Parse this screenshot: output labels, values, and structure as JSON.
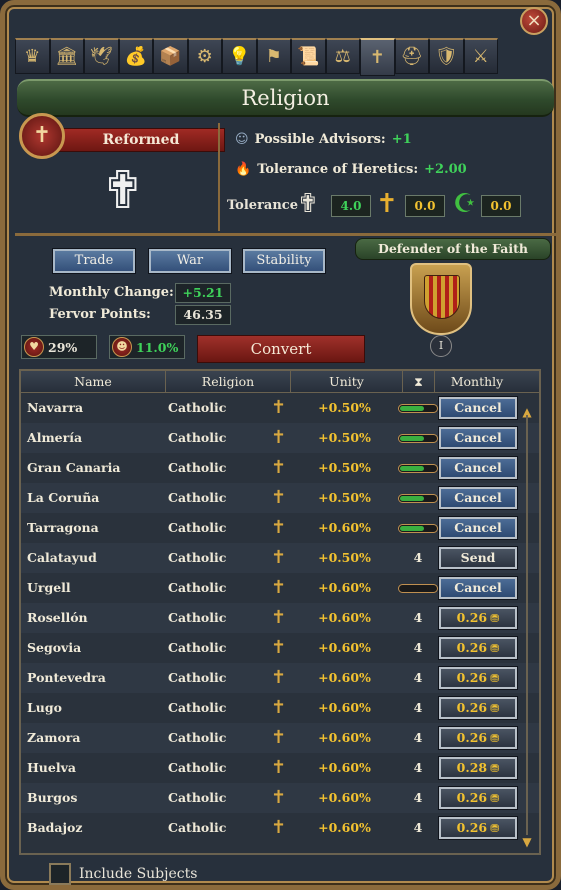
{
  "window": {
    "title": "Religion",
    "close_icon": "×"
  },
  "tabs": [
    {
      "icon": "crown-icon",
      "glyph": "♛"
    },
    {
      "icon": "courthouse-icon",
      "glyph": "🏛"
    },
    {
      "icon": "dove-icon",
      "glyph": "🕊"
    },
    {
      "icon": "money-bags-icon",
      "glyph": "💰"
    },
    {
      "icon": "trade-goods-icon",
      "glyph": "📦"
    },
    {
      "icon": "gears-icon",
      "glyph": "⚙"
    },
    {
      "icon": "lightbulb-icon",
      "glyph": "💡"
    },
    {
      "icon": "flag-icon",
      "glyph": "⚑"
    },
    {
      "icon": "scroll-icon",
      "glyph": "📜"
    },
    {
      "icon": "estates-icon",
      "glyph": "⚖"
    },
    {
      "icon": "religion-cross-icon",
      "glyph": "✝",
      "active": true
    },
    {
      "icon": "helmet-icon",
      "glyph": "⛑"
    },
    {
      "icon": "coat-of-arms-icon",
      "glyph": "🛡"
    },
    {
      "icon": "crossed-swords-icon",
      "glyph": "⚔"
    }
  ],
  "religion": {
    "name": "Reformed",
    "emblem_glyph": "✝",
    "cross_glyph": "✟",
    "possible_advisors_label": "Possible Advisors:",
    "possible_advisors_value": "+1",
    "tolerance_heretics_label": "Tolerance of Heretics:",
    "tolerance_heretics_value": "+2.00",
    "tolerance_label": "Tolerance",
    "tolerance": [
      {
        "icon": "reformed-cross-icon",
        "glyph": "✟",
        "value": "4.0",
        "color": "#f0f0f0"
      },
      {
        "icon": "catholic-cross-icon",
        "glyph": "✝",
        "value": "0.0",
        "color": "#e8b030"
      },
      {
        "icon": "crescent-icon",
        "glyph": "☪",
        "value": "0.0",
        "color": "#40c040"
      }
    ]
  },
  "fervor": {
    "buttons": [
      "Trade",
      "War",
      "Stability"
    ],
    "monthly_change_label": "Monthly Change:",
    "monthly_change_value": "+5.21",
    "fervor_points_label": "Fervor Points:",
    "fervor_points_value": "46.35",
    "defender_title": "Defender of the Faith",
    "defender_rank": "I",
    "religious_unity": "29%",
    "missionary_strength": "11.0%",
    "convert_label": "Convert"
  },
  "table": {
    "headers": [
      "Name",
      "Religion",
      "Unity",
      "⧗",
      "Monthly Cost"
    ],
    "rows": [
      {
        "name": "Navarra",
        "religion": "Catholic",
        "unity": "+0.50%",
        "timer": "bar",
        "progress": 0.6,
        "cost": "Cancel",
        "style": "blue"
      },
      {
        "name": "Almería",
        "religion": "Catholic",
        "unity": "+0.50%",
        "timer": "bar",
        "progress": 0.6,
        "cost": "Cancel",
        "style": "blue"
      },
      {
        "name": "Gran Canaria",
        "religion": "Catholic",
        "unity": "+0.50%",
        "timer": "bar",
        "progress": 0.6,
        "cost": "Cancel",
        "style": "blue"
      },
      {
        "name": "La Coruña",
        "religion": "Catholic",
        "unity": "+0.50%",
        "timer": "bar",
        "progress": 0.6,
        "cost": "Cancel",
        "style": "blue"
      },
      {
        "name": "Tarragona",
        "religion": "Catholic",
        "unity": "+0.60%",
        "timer": "bar",
        "progress": 0.6,
        "cost": "Cancel",
        "style": "blue"
      },
      {
        "name": "Calatayud",
        "religion": "Catholic",
        "unity": "+0.50%",
        "timer": "4",
        "cost": "Send",
        "style": "grey"
      },
      {
        "name": "Urgell",
        "religion": "Catholic",
        "unity": "+0.60%",
        "timer": "bar",
        "progress": 0.0,
        "cost": "Cancel",
        "style": "blue"
      },
      {
        "name": "Rosellón",
        "religion": "Catholic",
        "unity": "+0.60%",
        "timer": "4",
        "cost": "0.26",
        "style": "gold"
      },
      {
        "name": "Segovia",
        "religion": "Catholic",
        "unity": "+0.60%",
        "timer": "4",
        "cost": "0.26",
        "style": "gold"
      },
      {
        "name": "Pontevedra",
        "religion": "Catholic",
        "unity": "+0.60%",
        "timer": "4",
        "cost": "0.26",
        "style": "gold"
      },
      {
        "name": "Lugo",
        "religion": "Catholic",
        "unity": "+0.60%",
        "timer": "4",
        "cost": "0.26",
        "style": "gold"
      },
      {
        "name": "Zamora",
        "religion": "Catholic",
        "unity": "+0.60%",
        "timer": "4",
        "cost": "0.26",
        "style": "gold"
      },
      {
        "name": "Huelva",
        "religion": "Catholic",
        "unity": "+0.60%",
        "timer": "4",
        "cost": "0.28",
        "style": "gold"
      },
      {
        "name": "Burgos",
        "religion": "Catholic",
        "unity": "+0.60%",
        "timer": "4",
        "cost": "0.26",
        "style": "gold"
      },
      {
        "name": "Badajoz",
        "religion": "Catholic",
        "unity": "+0.60%",
        "timer": "4",
        "cost": "0.26",
        "style": "gold"
      }
    ]
  },
  "include_subjects_label": "Include Subjects"
}
